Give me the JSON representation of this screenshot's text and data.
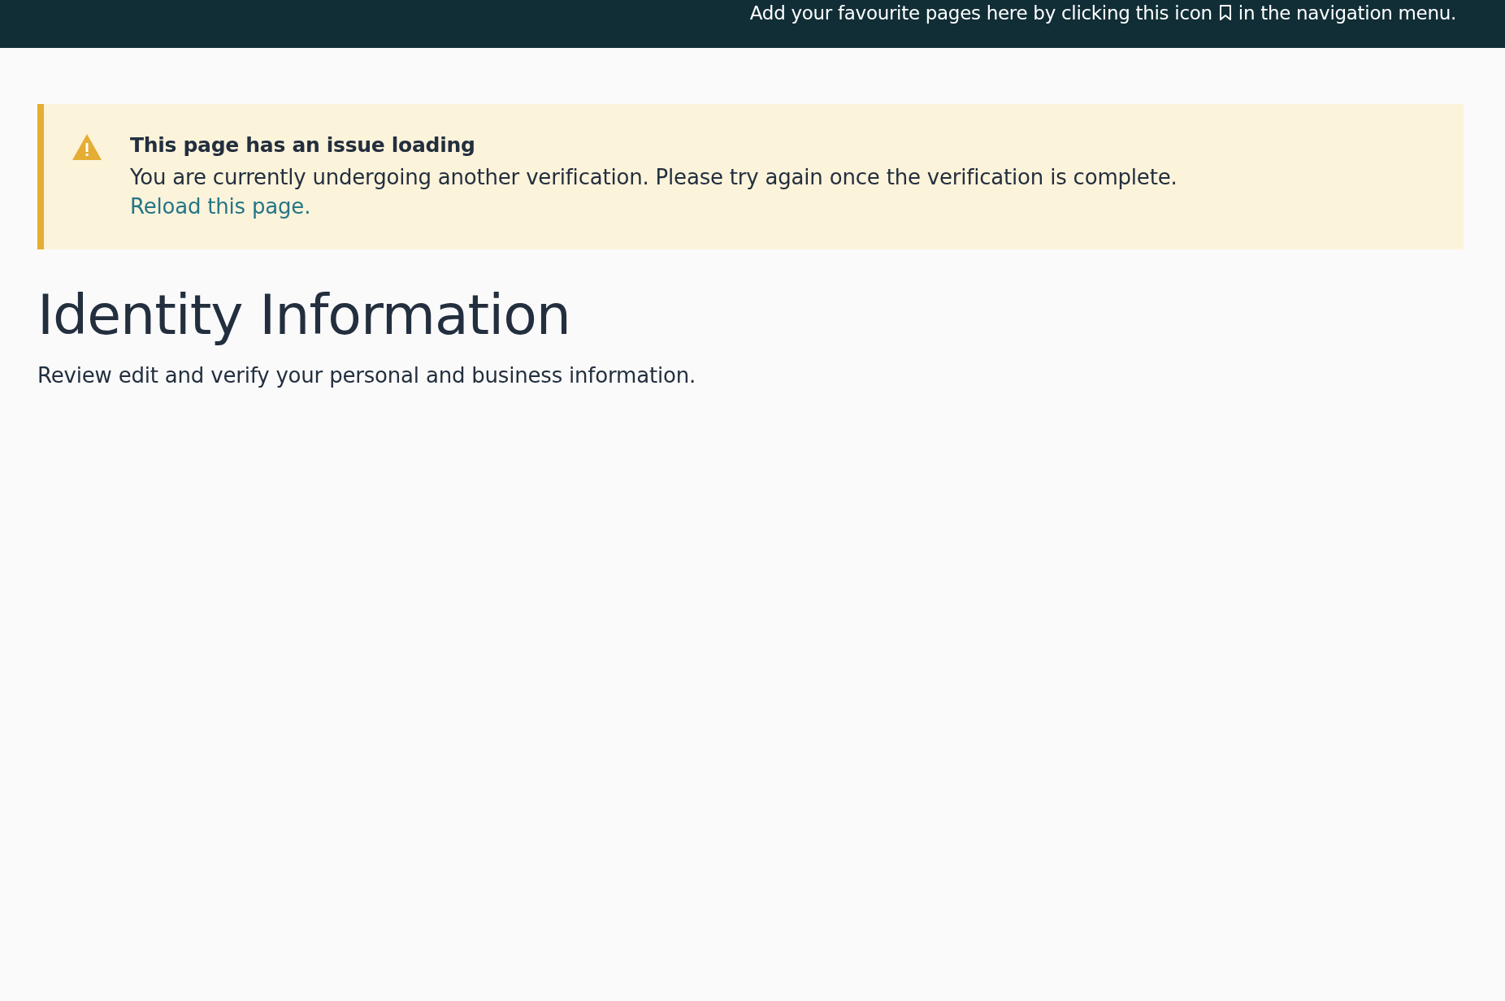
{
  "top_bar": {
    "hint_before": "Add your favourite pages here by clicking this icon",
    "hint_after": "in the navigation menu."
  },
  "alert": {
    "kind": "warning",
    "title": "This page has an issue loading",
    "message": "You are currently undergoing another verification. Please try again once the verification is complete.",
    "link": "Reload this page."
  },
  "page": {
    "title": "Identity Information",
    "subtitle": "Review edit and verify your personal and business information."
  }
}
